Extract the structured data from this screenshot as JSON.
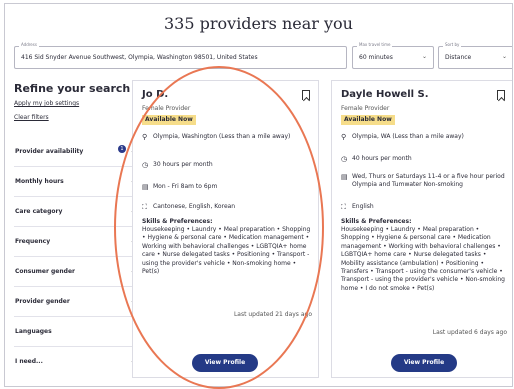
{
  "header": {
    "title": "335 providers near you"
  },
  "search": {
    "address_label": "Address",
    "address_value": "416 Sid Snyder Avenue Southwest, Olympia, Washington 98501, United States",
    "travel_label": "Max travel time",
    "travel_value": "60 minutes",
    "sort_label": "Sort by",
    "sort_value": "Distance"
  },
  "sidebar": {
    "title": "Refine your search",
    "apply_link": "Apply my job settings",
    "clear_link": "Clear filters",
    "filters": [
      {
        "label": "Provider availability",
        "badge": "1"
      },
      {
        "label": "Monthly hours"
      },
      {
        "label": "Care category"
      },
      {
        "label": "Frequency"
      },
      {
        "label": "Consumer gender"
      },
      {
        "label": "Provider gender"
      },
      {
        "label": "Languages"
      },
      {
        "label": "I need..."
      }
    ]
  },
  "cards": [
    {
      "name": "Jo D.",
      "type": "Female Provider",
      "availability": "Available Now",
      "location": "Olympia, Washington (Less than a mile away)",
      "hours": "30 hours per month",
      "schedule": "Mon - Fri 8am to 6pm",
      "languages": "Cantonese, English, Korean",
      "skills_heading": "Skills & Preferences:",
      "skills": "Housekeeping • Laundry • Meal preparation • Shopping • Hygiene & personal care • Medication management • Working with behavioral challenges • LGBTQIA+ home care • Nurse delegated tasks • Positioning • Transport - using the provider's vehicle • Non-smoking home • Pet(s)",
      "updated": "Last updated 21 days ago",
      "button": "View Profile"
    },
    {
      "name": "Dayle Howell S.",
      "type": "Female Provider",
      "availability": "Available Now",
      "location": "Olympia, WA (Less than a mile away)",
      "hours": "40 hours per month",
      "schedule": "Wed, Thurs or Saturdays 11-4 or a five hour period Olympia and Tumwater Non-smoking",
      "languages": "English",
      "skills_heading": "Skills & Preferences:",
      "skills": "Housekeeping • Laundry • Meal preparation • Shopping • Hygiene & personal care • Medication management • Working with behavioral challenges • LGBTQIA+ home care • Nurse delegated tasks • Mobility assistance (ambulation) • Positioning • Transfers • Transport - using the consumer's vehicle • Transport - using the provider's vehicle • Non-smoking home • I do not smoke • Pet(s)",
      "updated": "Last updated 6 days ago",
      "button": "View Profile"
    }
  ],
  "colors": {
    "accent": "#243a86",
    "available": "#f6dd8a",
    "annotation": "#e97753"
  }
}
